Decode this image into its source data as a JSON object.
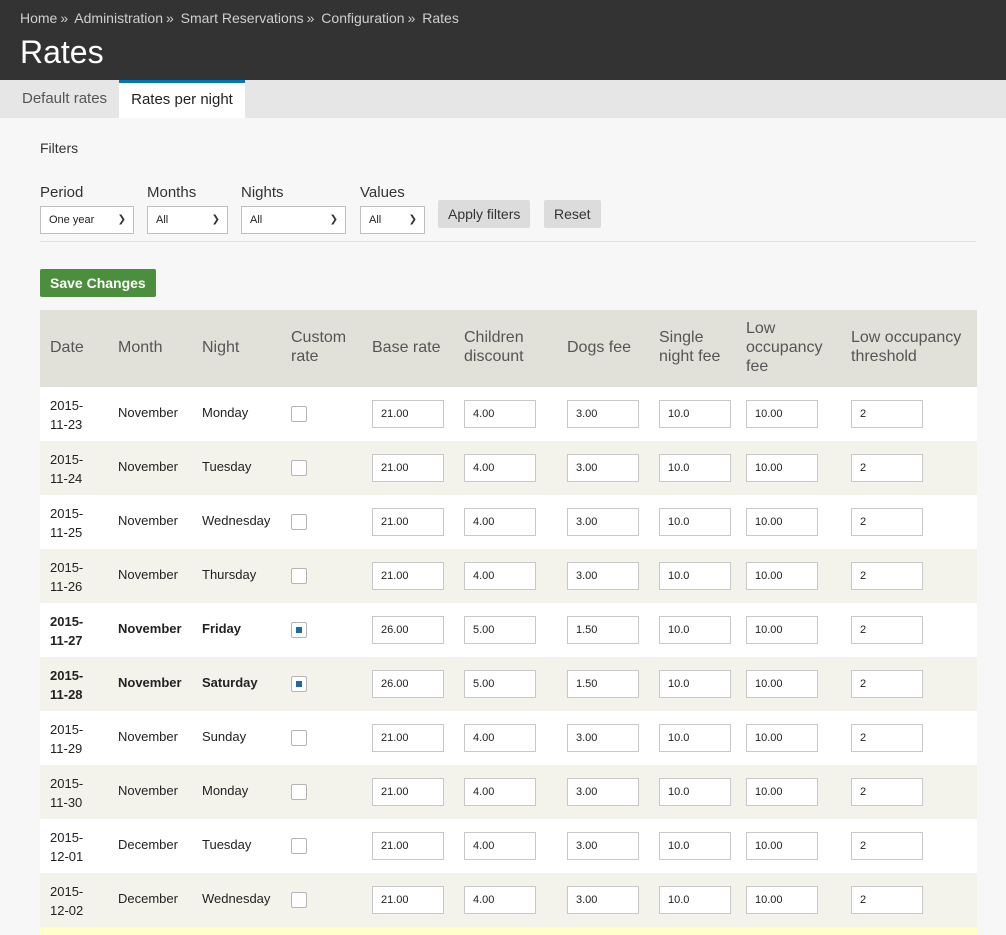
{
  "breadcrumb": [
    "Home",
    "Administration",
    "Smart Reservations",
    "Configuration",
    "Rates"
  ],
  "breadcrumb_separator": "»",
  "page_title": "Rates",
  "tabs": [
    {
      "label": "Default rates",
      "active": false
    },
    {
      "label": "Rates per night",
      "active": true
    }
  ],
  "filters": {
    "title": "Filters",
    "period": {
      "label": "Period",
      "value": "One year"
    },
    "months": {
      "label": "Months",
      "value": "All"
    },
    "nights": {
      "label": "Nights",
      "value": "All"
    },
    "values": {
      "label": "Values",
      "value": "All"
    },
    "apply_label": "Apply filters",
    "reset_label": "Reset"
  },
  "save_label": "Save Changes",
  "colors": {
    "header_bg": "#333333",
    "save_button": "#4a8e3e",
    "active_tab_border": "#0074bd",
    "checkbox_checked": "#1e6aa8"
  },
  "table": {
    "headers": [
      "Date",
      "Month",
      "Night",
      "Custom rate",
      "Base rate",
      "Children discount",
      "Dogs fee",
      "Single night fee",
      "Low occupancy fee",
      "Low occupancy threshold"
    ],
    "rows": [
      {
        "date_a": "2015-",
        "date_b": "11-23",
        "month": "November",
        "night": "Monday",
        "custom": false,
        "base": "21.00",
        "children": "4.00",
        "dogs": "3.00",
        "single": "10.0",
        "low_fee": "10.00",
        "threshold": "2"
      },
      {
        "date_a": "2015-",
        "date_b": "11-24",
        "month": "November",
        "night": "Tuesday",
        "custom": false,
        "base": "21.00",
        "children": "4.00",
        "dogs": "3.00",
        "single": "10.0",
        "low_fee": "10.00",
        "threshold": "2"
      },
      {
        "date_a": "2015-",
        "date_b": "11-25",
        "month": "November",
        "night": "Wednesday",
        "custom": false,
        "base": "21.00",
        "children": "4.00",
        "dogs": "3.00",
        "single": "10.0",
        "low_fee": "10.00",
        "threshold": "2"
      },
      {
        "date_a": "2015-",
        "date_b": "11-26",
        "month": "November",
        "night": "Thursday",
        "custom": false,
        "base": "21.00",
        "children": "4.00",
        "dogs": "3.00",
        "single": "10.0",
        "low_fee": "10.00",
        "threshold": "2"
      },
      {
        "date_a": "2015-",
        "date_b": "11-27",
        "month": "November",
        "night": "Friday",
        "custom": true,
        "base": "26.00",
        "children": "5.00",
        "dogs": "1.50",
        "single": "10.0",
        "low_fee": "10.00",
        "threshold": "2"
      },
      {
        "date_a": "2015-",
        "date_b": "11-28",
        "month": "November",
        "night": "Saturday",
        "custom": true,
        "base": "26.00",
        "children": "5.00",
        "dogs": "1.50",
        "single": "10.0",
        "low_fee": "10.00",
        "threshold": "2"
      },
      {
        "date_a": "2015-",
        "date_b": "11-29",
        "month": "November",
        "night": "Sunday",
        "custom": false,
        "base": "21.00",
        "children": "4.00",
        "dogs": "3.00",
        "single": "10.0",
        "low_fee": "10.00",
        "threshold": "2"
      },
      {
        "date_a": "2015-",
        "date_b": "11-30",
        "month": "November",
        "night": "Monday",
        "custom": false,
        "base": "21.00",
        "children": "4.00",
        "dogs": "3.00",
        "single": "10.0",
        "low_fee": "10.00",
        "threshold": "2"
      },
      {
        "date_a": "2015-",
        "date_b": "12-01",
        "month": "December",
        "night": "Tuesday",
        "custom": false,
        "base": "21.00",
        "children": "4.00",
        "dogs": "3.00",
        "single": "10.0",
        "low_fee": "10.00",
        "threshold": "2"
      },
      {
        "date_a": "2015-",
        "date_b": "12-02",
        "month": "December",
        "night": "Wednesday",
        "custom": false,
        "base": "21.00",
        "children": "4.00",
        "dogs": "3.00",
        "single": "10.0",
        "low_fee": "10.00",
        "threshold": "2"
      }
    ]
  }
}
